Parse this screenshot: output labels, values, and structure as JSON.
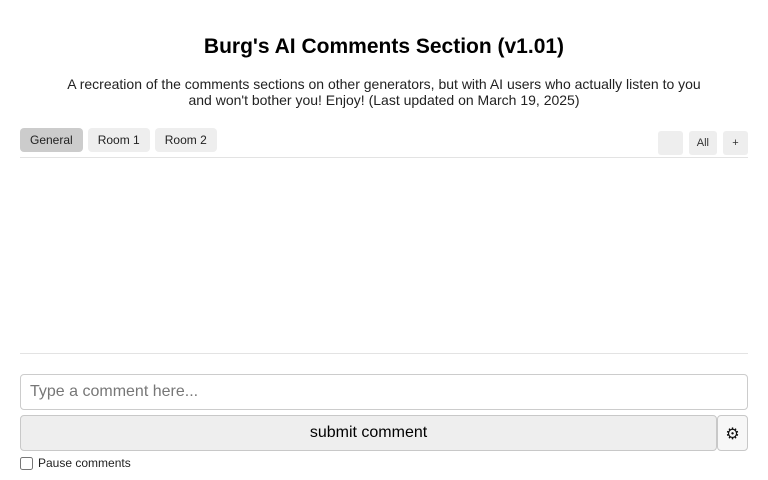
{
  "header": {
    "title": "Burg's AI Comments Section (v1.01)",
    "description": "A recreation of the comments sections on other generators, but with AI users who actually listen to you and won't bother you! Enjoy! (Last updated on March 19, 2025)"
  },
  "rooms": {
    "tabs": [
      {
        "label": "General",
        "active": true
      },
      {
        "label": "Room 1",
        "active": false
      },
      {
        "label": "Room 2",
        "active": false
      }
    ],
    "tools": {
      "icon_button_label": "",
      "all_button_label": " All",
      "add_button_label": "+"
    }
  },
  "composer": {
    "placeholder": "Type a comment here...",
    "value": "",
    "submit_label": "submit comment",
    "settings_icon": "⚙",
    "pause_label": "Pause comments",
    "pause_checked": false
  },
  "colors": {
    "active_tab": "#cccccc",
    "inactive_tab": "#eeeeee",
    "divider": "#e3e3e3"
  }
}
